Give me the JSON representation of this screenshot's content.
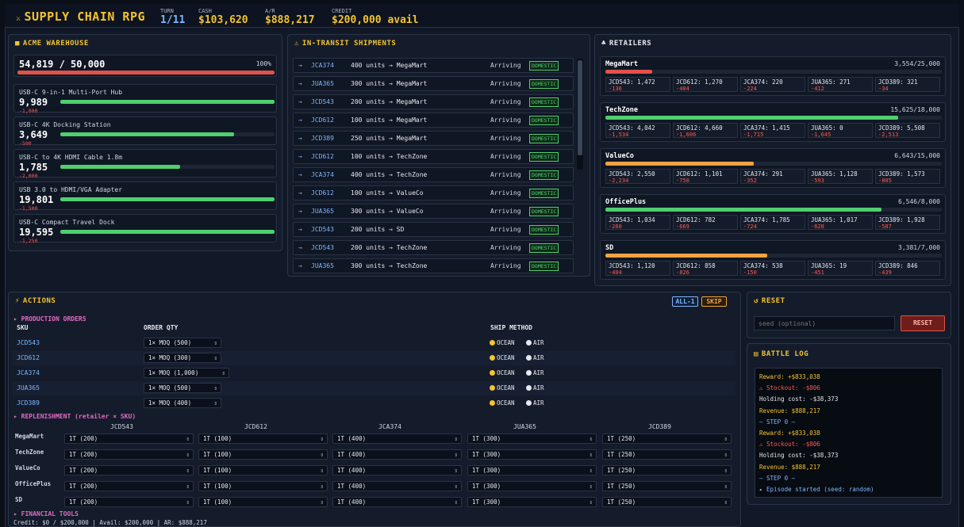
{
  "header": {
    "title": "SUPPLY CHAIN RPG",
    "turn_label": "TURN",
    "turn_value": "1/11",
    "cash_label": "CASH",
    "cash_value": "$103,620",
    "ar_label": "A/R",
    "ar_value": "$888,217",
    "credit_label": "CREDIT",
    "credit_value": "$200,000 avail"
  },
  "warehouse": {
    "title": "ACME WAREHOUSE",
    "capacity_text": "54,819 / 50,000",
    "capacity_pct_text": "100%",
    "capacity_fraction": 1.0,
    "items": [
      {
        "name": "USB-C 9-in-1 Multi-Port Hub",
        "qty": "9,989",
        "delta": "-1,000",
        "fill": 1.0
      },
      {
        "name": "USB-C 4K Docking Station",
        "qty": "3,649",
        "delta": "-500",
        "fill": 0.81
      },
      {
        "name": "USB-C to 4K HDMI Cable 1.8m",
        "qty": "1,785",
        "delta": "-2,000",
        "fill": 0.56
      },
      {
        "name": "USB 3.0 to HDMI/VGA Adapter",
        "qty": "19,801",
        "delta": "-1,500",
        "fill": 1.0
      },
      {
        "name": "USB-C Compact Travel Dock",
        "qty": "19,595",
        "delta": "-1,250",
        "fill": 1.0
      }
    ]
  },
  "transit": {
    "title": "IN-TRANSIT SHIPMENTS",
    "rows": [
      {
        "code": "JCA374",
        "desc": "400 units → MegaMart",
        "status": "Arriving",
        "badge": "DOMESTIC"
      },
      {
        "code": "JUA365",
        "desc": "300 units → MegaMart",
        "status": "Arriving",
        "badge": "DOMESTIC"
      },
      {
        "code": "JCD543",
        "desc": "200 units → MegaMart",
        "status": "Arriving",
        "badge": "DOMESTIC"
      },
      {
        "code": "JCD612",
        "desc": "100 units → MegaMart",
        "status": "Arriving",
        "badge": "DOMESTIC"
      },
      {
        "code": "JCD389",
        "desc": "250 units → MegaMart",
        "status": "Arriving",
        "badge": "DOMESTIC"
      },
      {
        "code": "JCD612",
        "desc": "100 units → TechZone",
        "status": "Arriving",
        "badge": "DOMESTIC"
      },
      {
        "code": "JCA374",
        "desc": "400 units → TechZone",
        "status": "Arriving",
        "badge": "DOMESTIC"
      },
      {
        "code": "JCD612",
        "desc": "100 units → ValueCo",
        "status": "Arriving",
        "badge": "DOMESTIC"
      },
      {
        "code": "JUA365",
        "desc": "300 units → ValueCo",
        "status": "Arriving",
        "badge": "DOMESTIC"
      },
      {
        "code": "JCD543",
        "desc": "200 units → SD",
        "status": "Arriving",
        "badge": "DOMESTIC"
      },
      {
        "code": "JCD543",
        "desc": "200 units → TechZone",
        "status": "Arriving",
        "badge": "DOMESTIC"
      },
      {
        "code": "JUA365",
        "desc": "300 units → TechZone",
        "status": "Arriving",
        "badge": "DOMESTIC"
      }
    ]
  },
  "retailers": {
    "title": "RETAILERS",
    "list": [
      {
        "name": "MegaMart",
        "total": "3,554/25,000",
        "fill": 0.14,
        "color": "#e0524a",
        "cells": [
          {
            "code": "JCD543: 1,472",
            "delta": "-136"
          },
          {
            "code": "JCD612: 1,270",
            "delta": "-404"
          },
          {
            "code": "JCA374: 220",
            "delta": "-224"
          },
          {
            "code": "JUA365: 271",
            "delta": "-412"
          },
          {
            "code": "JCD389: 321",
            "delta": "-34"
          }
        ]
      },
      {
        "name": "TechZone",
        "total": "15,625/18,000",
        "fill": 0.87,
        "color": "#4fd070",
        "cells": [
          {
            "code": "JCD543: 4,042",
            "delta": "-1,534"
          },
          {
            "code": "JCD612: 4,660",
            "delta": "-1,606"
          },
          {
            "code": "JCA374: 1,415",
            "delta": "-1,715"
          },
          {
            "code": "JUA365: 0",
            "delta": "-1,645"
          },
          {
            "code": "JCD389: 5,508",
            "delta": "-2,513"
          }
        ]
      },
      {
        "name": "ValueCo",
        "total": "6,643/15,000",
        "fill": 0.44,
        "color": "#f2a240",
        "cells": [
          {
            "code": "JCD543: 2,550",
            "delta": "-2,234"
          },
          {
            "code": "JCD612: 1,101",
            "delta": "-750"
          },
          {
            "code": "JCA374: 291",
            "delta": "-352"
          },
          {
            "code": "JUA365: 1,128",
            "delta": "-593"
          },
          {
            "code": "JCD389: 1,573",
            "delta": "-805"
          }
        ]
      },
      {
        "name": "OfficePlus",
        "total": "6,546/8,000",
        "fill": 0.82,
        "color": "#4fd070",
        "cells": [
          {
            "code": "JCD543: 1,034",
            "delta": "-260"
          },
          {
            "code": "JCD612: 782",
            "delta": "-669"
          },
          {
            "code": "JCA374: 1,785",
            "delta": "-724"
          },
          {
            "code": "JUA365: 1,017",
            "delta": "-628"
          },
          {
            "code": "JCD389: 1,928",
            "delta": "-587"
          }
        ]
      },
      {
        "name": "SD",
        "total": "3,381/7,000",
        "fill": 0.48,
        "color": "#f2a240",
        "cells": [
          {
            "code": "JCD543: 1,120",
            "delta": "-404"
          },
          {
            "code": "JCD612: 858",
            "delta": "-826"
          },
          {
            "code": "JCA374: 538",
            "delta": "-150"
          },
          {
            "code": "JUA365: 19",
            "delta": "-451"
          },
          {
            "code": "JCD389: 846",
            "delta": "-439"
          }
        ]
      }
    ]
  },
  "actions": {
    "title": "ACTIONS",
    "all1_label": "ALL-1",
    "skip_label": "SKIP",
    "production_title": "PRODUCTION ORDERS",
    "col_sku": "SKU",
    "col_qty": "ORDER QTY",
    "col_ship": "SHIP METHOD",
    "ocean_label": "OCEAN",
    "air_label": "AIR",
    "production_rows": [
      {
        "sku": "JCD543",
        "qty": "1× MOQ (500)"
      },
      {
        "sku": "JCD612",
        "qty": "1× MOQ (300)"
      },
      {
        "sku": "JCA374",
        "qty": "1× MOQ (1,000)"
      },
      {
        "sku": "JUA365",
        "qty": "1× MOQ (500)"
      },
      {
        "sku": "JCD389",
        "qty": "1× MOQ (400)"
      }
    ],
    "replenishment_title": "REPLENISHMENT (retailer × SKU)",
    "replenishment_cols": [
      "JCD543",
      "JCD612",
      "JCA374",
      "JUA365",
      "JCD389"
    ],
    "replenishment_values": [
      "1T (200)",
      "1T (100)",
      "1T (400)",
      "1T (300)",
      "1T (250)"
    ],
    "replenishment_rows": [
      "MegaMart",
      "TechZone",
      "ValueCo",
      "OfficePlus",
      "SD"
    ],
    "financial_title": "FINANCIAL TOOLS",
    "financial_text": "Credit: $0 / $200,000 | Avail: $200,000 | AR: $888,217"
  },
  "reset": {
    "title": "RESET",
    "seed_placeholder": "seed (optional)",
    "button_label": "RESET"
  },
  "battle_log": {
    "title": "BATTLE LOG",
    "lines": [
      {
        "text": "Reward: +$833,038",
        "color": "#f4c430"
      },
      {
        "text": "⚠ Stockout: -$806",
        "color": "#ff5a4e"
      },
      {
        "text": "Holding cost: -$38,373",
        "color": "#e6e8ee"
      },
      {
        "text": "Revenue: $888,217",
        "color": "#f4c430"
      },
      {
        "text": "— STEP 0 —",
        "color": "#7fb6ff"
      },
      {
        "text": "Reward: +$833,038",
        "color": "#f4c430"
      },
      {
        "text": "⚠ Stockout: -$806",
        "color": "#ff5a4e"
      },
      {
        "text": "Holding cost: -$38,373",
        "color": "#e6e8ee"
      },
      {
        "text": "Revenue: $888,217",
        "color": "#f4c430"
      },
      {
        "text": "— STEP 0 —",
        "color": "#7fb6ff"
      },
      {
        "text": "▸ Episode started (seed: random)",
        "color": "#7fb6ff"
      }
    ]
  }
}
